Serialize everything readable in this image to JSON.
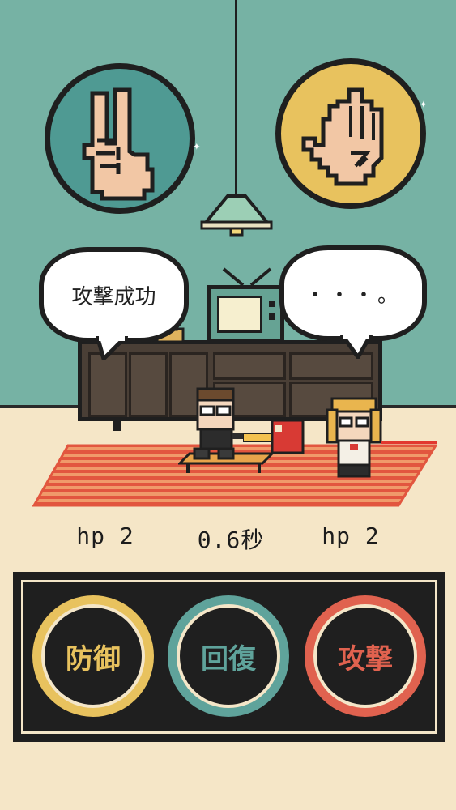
{
  "scene": {
    "player_speech": "攻撃成功",
    "enemy_speech": "・・・。"
  },
  "hands": {
    "player_hand": "scissors-hand-icon",
    "enemy_hand": "paper-hand-icon"
  },
  "stats": {
    "player_hp": "hp 2",
    "timer": "0.6秒",
    "enemy_hp": "hp 2"
  },
  "actions": {
    "defend_label": "防御",
    "heal_label": "回復",
    "attack_label": "攻撃"
  },
  "colors": {
    "wall": "#76b2a4",
    "floor": "#f5e6c7",
    "defend": "#e8c25e",
    "heal": "#5fa39b",
    "attack": "#e0624f",
    "panel": "#1f1f1f"
  }
}
